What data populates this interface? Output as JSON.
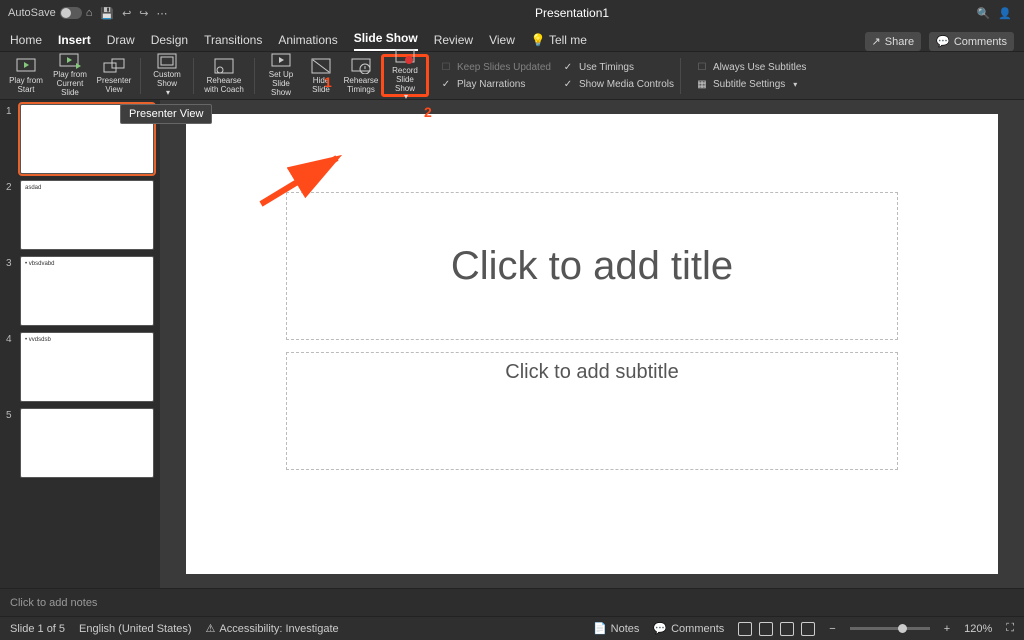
{
  "titlebar": {
    "autosave": "AutoSave",
    "title": "Presentation1"
  },
  "tabs": {
    "home": "Home",
    "insert": "Insert",
    "draw": "Draw",
    "design": "Design",
    "transitions": "Transitions",
    "animations": "Animations",
    "slideshow": "Slide Show",
    "review": "Review",
    "view": "View",
    "tellme": "Tell me",
    "share": "Share",
    "comments": "Comments"
  },
  "ribbon": {
    "play_from_start": "Play from Start",
    "play_from_current": "Play from Current Slide",
    "presenter_view": "Presenter View",
    "custom_show": "Custom Show",
    "rehearse_coach": "Rehearse with Coach",
    "set_up_show": "Set Up Slide Show",
    "hide_slide": "Hide Slide",
    "rehearse_timings": "Rehearse Timings",
    "record_show": "Record Slide Show",
    "keep_slides_updated": "Keep Slides Updated",
    "play_narrations": "Play Narrations",
    "use_timings": "Use Timings",
    "show_media_controls": "Show Media Controls",
    "always_use_subtitles": "Always Use Subtitles",
    "subtitle_settings": "Subtitle Settings"
  },
  "tooltip": {
    "presenter": "Presenter View"
  },
  "slide_thumbs": {
    "t2": "asdad",
    "t3": "• vbsdvabd",
    "t4": "• vvdsdsb"
  },
  "slide": {
    "title_ph": "Click to add title",
    "subtitle_ph": "Click to add subtitle"
  },
  "annotations": {
    "n1": "1",
    "n2": "2"
  },
  "notes": {
    "placeholder": "Click to add notes"
  },
  "status": {
    "slide_of": "Slide 1 of 5",
    "lang": "English (United States)",
    "accessibility": "Accessibility: Investigate",
    "notes": "Notes",
    "comments": "Comments",
    "zoom": "120%"
  }
}
